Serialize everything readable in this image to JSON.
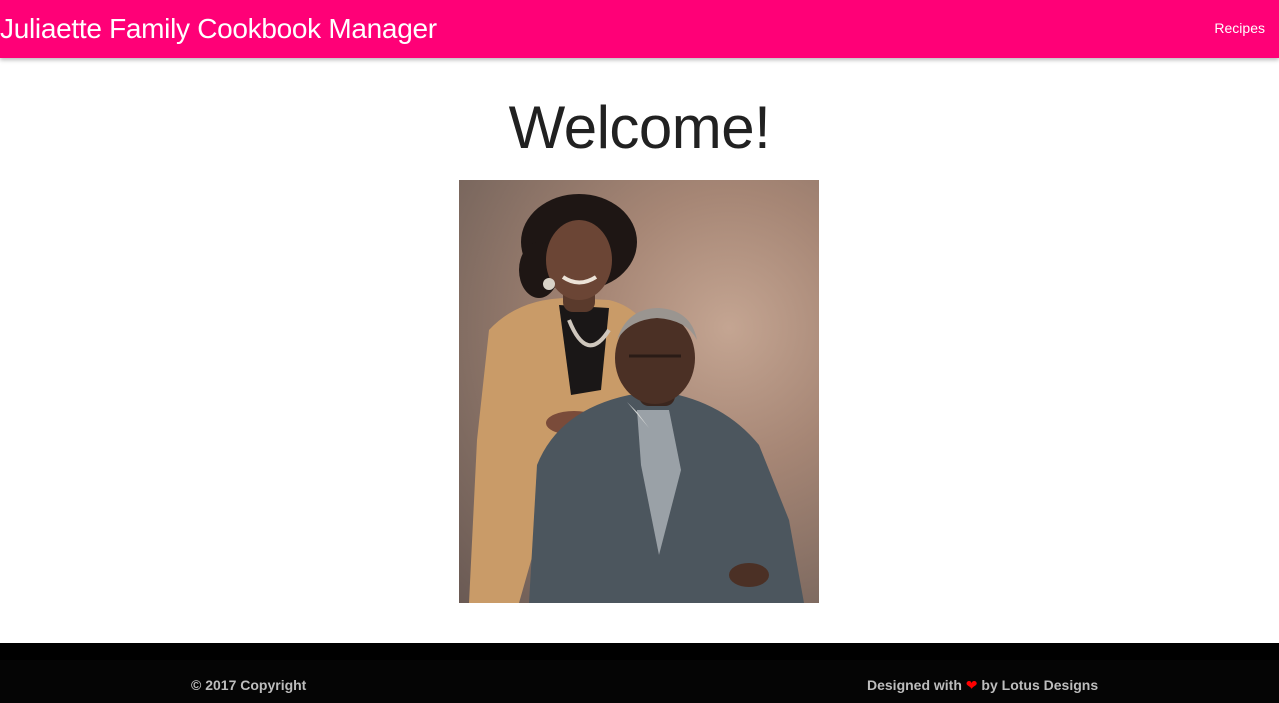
{
  "header": {
    "brand": "Juliaette Family Cookbook Manager",
    "nav": [
      {
        "label": "Recipes"
      }
    ]
  },
  "main": {
    "heading": "Welcome!",
    "photo_alt": "Portrait of a smiling older couple, woman standing behind seated man in a gray suit"
  },
  "footer": {
    "copyright": "© 2017 Copyright",
    "credit_prefix": "Designed with",
    "credit_heart": "❤",
    "credit_suffix": "by Lotus Designs"
  },
  "colors": {
    "accent": "#ff0077",
    "footer_bg": "#050505",
    "heart": "#ff0000"
  }
}
